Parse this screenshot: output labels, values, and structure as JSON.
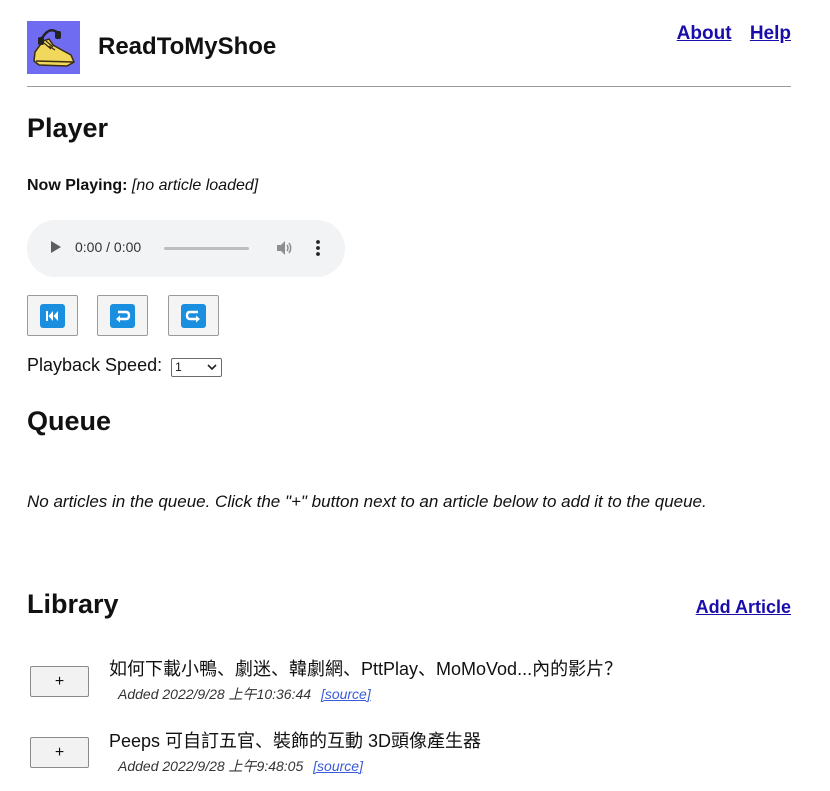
{
  "app": {
    "title": "ReadToMyShoe",
    "logo_icon": "sneaker-icon",
    "logo_bg": "#6f6cf2"
  },
  "nav": {
    "about": "About",
    "help": "Help"
  },
  "player": {
    "heading": "Player",
    "now_playing_label": "Now Playing:",
    "now_playing_value": "[no article loaded]",
    "audio": {
      "time": "0:00 / 0:00"
    },
    "controls": [
      {
        "name": "skip-back-icon"
      },
      {
        "name": "rewind-icon"
      },
      {
        "name": "forward-icon"
      }
    ],
    "speed_label": "Playback Speed:",
    "speed_value": "1"
  },
  "queue": {
    "heading": "Queue",
    "empty_message": "No articles in the queue. Click the \"+\" button next to an article below to add it to the queue."
  },
  "library": {
    "heading": "Library",
    "add_article": "Add Article",
    "items": [
      {
        "add": "+",
        "title": "如何下載小鴨、劇迷、韓劇網、PttPlay、MoMoVod...內的影片？",
        "added": "Added 2022/9/28 上午10:36:44",
        "source": "[source]"
      },
      {
        "add": "+",
        "title": "Peeps 可自訂五官、裝飾的互動 3D頭像產生器",
        "added": "Added 2022/9/28 上午9:48:05",
        "source": "[source]"
      }
    ]
  },
  "colors": {
    "link": "#1a0dab",
    "control_blue": "#1a8fe0"
  }
}
